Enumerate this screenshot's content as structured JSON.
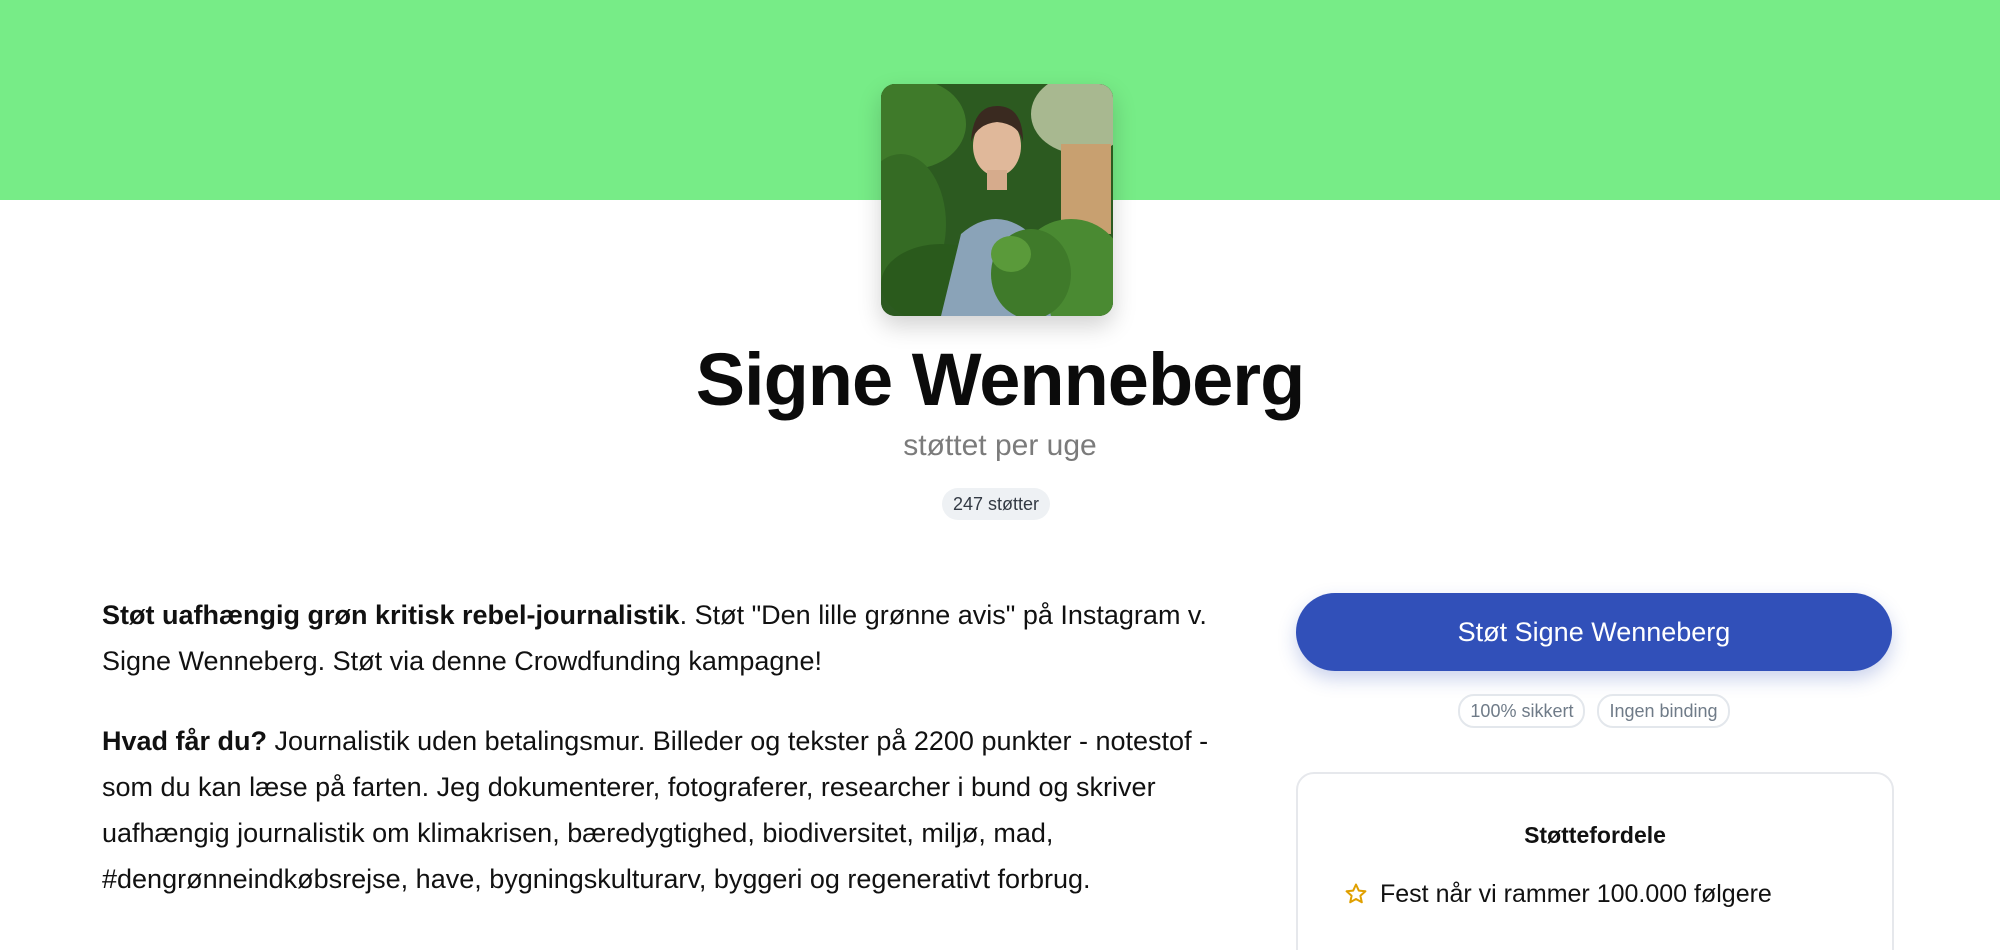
{
  "profile": {
    "name": "Signe Wenneberg",
    "subtitle": "støttet per uge",
    "supporters": "247 støtter",
    "avatar_icon": "profile-photo"
  },
  "description": {
    "p1_bold": "Støt uafhængig grøn kritisk rebel-journalistik",
    "p1_rest": ". Støt \"Den lille grønne avis\" på Instagram v. Signe Wenneberg. Støt via denne Crowdfunding kampagne!",
    "p2_bold": "Hvad får du?",
    "p2_rest": " Journalistik uden betalingsmur. Billeder og tekster på 2200 punkter - notestof - som du kan læse på farten. Jeg dokumenterer, fotograferer, researcher i bund og skriver uafhængig journalistik om klimakrisen, bæredygtighed, biodiversitet, miljø, mad, #dengrønneindkøbsrejse, have, bygningskulturarv, byggeri og regenerativt forbrug."
  },
  "support": {
    "button_label": "Støt Signe Wenneberg",
    "badges": [
      "100% sikkert",
      "Ingen binding"
    ]
  },
  "perks": {
    "title": "Støttefordele",
    "items": [
      {
        "icon": "star-icon",
        "label": "Fest når vi rammer 100.000 følgere"
      }
    ]
  },
  "colors": {
    "cover": "#77ec87",
    "button": "#3150b9",
    "star": "#e0a000"
  }
}
